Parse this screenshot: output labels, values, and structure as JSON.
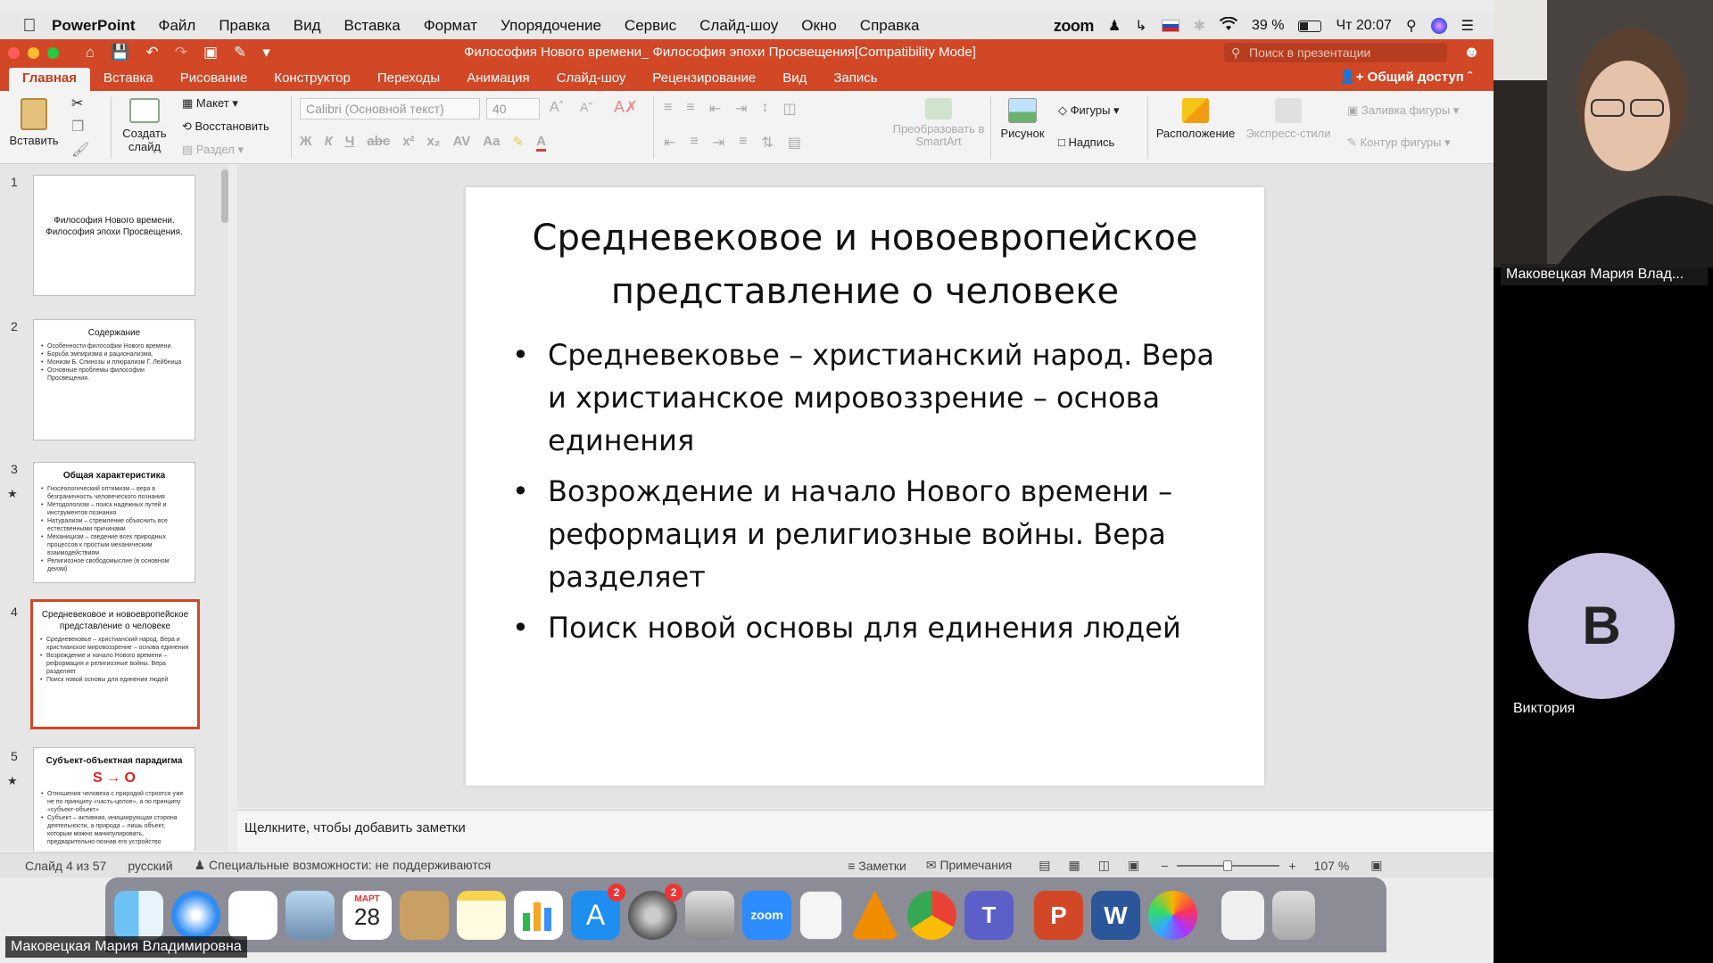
{
  "menubar": {
    "app": "PowerPoint",
    "items": [
      "Файл",
      "Правка",
      "Вид",
      "Вставка",
      "Формат",
      "Упорядочение",
      "Сервис",
      "Слайд-шоу",
      "Окно",
      "Справка"
    ],
    "zoom": "zoom",
    "battery": "39 %",
    "clock": "Чт 20:07"
  },
  "titlebar": {
    "title": "Философия Нового времени_ Философия эпохи Просвещения[Compatibility Mode]",
    "search_placeholder": "Поиск в презентации"
  },
  "tabs": {
    "items": [
      "Главная",
      "Вставка",
      "Рисование",
      "Конструктор",
      "Переходы",
      "Анимация",
      "Слайд-шоу",
      "Рецензирование",
      "Вид",
      "Запись"
    ],
    "share": "Общий доступ"
  },
  "ribbon": {
    "paste": "Вставить",
    "new_slide": "Создать слайд",
    "layout": "Макет",
    "reset": "Восстановить",
    "section": "Раздел",
    "font": "Calibri (Основной текст)",
    "size": "40",
    "smartart": "Преобразовать в SmartArt",
    "picture": "Рисунок",
    "shapes": "Фигуры",
    "textbox": "Надпись",
    "arrange": "Расположение",
    "quick_styles": "Экспресс-стили",
    "shape_fill": "Заливка фигуры",
    "shape_outline": "Контур фигуры"
  },
  "thumbnails": [
    {
      "num": "1",
      "title": "Философия Нового времени. Философия эпохи Просвещения.",
      "bullets": []
    },
    {
      "num": "2",
      "title": "Содержание",
      "bullets": [
        "Особенности философии Нового времени.",
        "Борьба эмпиризма и рационализма.",
        "Монизм Б. Спинозы и плюрализм Г. Лейбница",
        "Основные проблемы философии Просвещения."
      ]
    },
    {
      "num": "3",
      "title": "Общая характеристика",
      "bullets": [
        "Гносеологический оптимизм – вера в безграничность человеческого познания",
        "Методологизм – поиск надежных путей и инструментов познания",
        "Натурализм – стремление объяснить все естественными причинами",
        "Механицизм – сведение всех природных процессов к простым механическим взаимодействиям",
        "Религиозное свободомыслие (в основном деизм)"
      ]
    },
    {
      "num": "4",
      "title": "Средневековое и новоевропейское представление о человеке",
      "bullets": [
        "Средневековье – христианский народ. Вера и христианское мировоззрение – основа единения",
        "Возрождение и начало Нового времени – реформация и религиозные войны. Вера разделяет",
        "Поиск новой основы для единения людей"
      ]
    },
    {
      "num": "5",
      "title": "Субъект-объектная парадигма",
      "formula": "S → O",
      "bullets": [
        "Отношения человека с природой строятся уже не по принципу «часть-целое», а по принципу «субъект-объект»",
        "Субъект – активная, инициирующая сторона деятельности, а природа – лишь объект, которым можно манипулировать, предварительно познав его устройство"
      ]
    }
  ],
  "slide": {
    "title": "Средневековое и новоевропейское представление о человеке",
    "bullets": [
      "Средневековье – христианский народ. Вера и христианское мировоззрение – основа единения",
      "Возрождение и начало Нового времени – реформация и религиозные войны. Вера разделяет",
      "Поиск новой основы для единения людей"
    ]
  },
  "notes": {
    "placeholder": "Щелкните, чтобы добавить заметки"
  },
  "status": {
    "slide_counter": "Слайд 4 из 57",
    "language": "русский",
    "accessibility": "Специальные возможности: не поддерживаются",
    "notes_button": "Заметки",
    "comments_button": "Примечания",
    "zoom_level": "107 %"
  },
  "dock": {
    "calendar_month": "МАРТ",
    "calendar_day": "28",
    "appstore_badge": "2",
    "settings_badge": "2"
  },
  "zoom_panel": {
    "speaker_name": "Маковецкая Мария Влад...",
    "participant_initial": "В",
    "participant_name": "Виктория",
    "bottom_name": "Маковецкая Мария Владимировна"
  }
}
